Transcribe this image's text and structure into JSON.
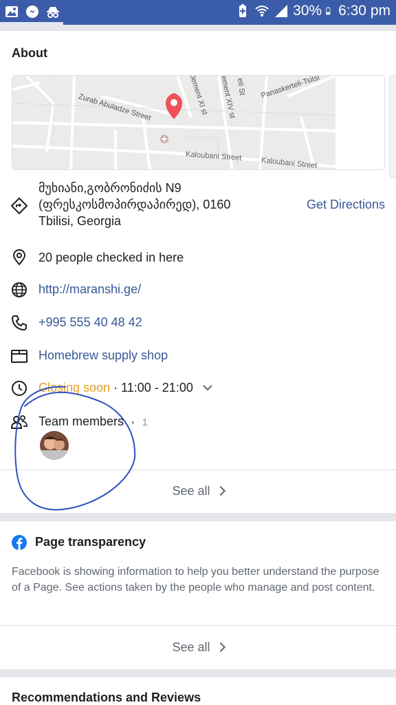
{
  "status_bar": {
    "battery": "30%",
    "time": "6:30 pm",
    "color": "#3b5ca8",
    "left_icons": [
      "gallery-icon",
      "messenger-icon",
      "incognito-icon"
    ],
    "right_icons": [
      "battery-saver-icon",
      "wifi-icon",
      "signal-icon",
      "battery-icon"
    ]
  },
  "about": {
    "title": "About",
    "map": {
      "streets": [
        "Zurab Abuladze Street",
        "Kaloubani Street",
        "Kaloubani Street",
        "ttlement XI st",
        "ement XIV st",
        "eti St",
        "Panaskerteli-Tsitsi"
      ],
      "pin_color": "#f0505a"
    },
    "address_line1": "მუხიანი,გობრონიძის N9",
    "address_line2": "(ფრესკოსმოპირდაპირედ), 0160",
    "address_line3": "Tbilisi, Georgia",
    "directions_label": "Get Directions",
    "checkins": "20 people checked in here",
    "website": "http://maranshi.ge/",
    "phone": "+995 555 40 48 42",
    "category": "Homebrew supply shop",
    "hours_status": "Closing soon",
    "hours_separator": "·",
    "hours": "11:00 - 21:00",
    "team_label": "Team members",
    "team_bullet": "•",
    "team_count": "1",
    "see_all": "See all"
  },
  "transparency": {
    "title": "Page transparency",
    "text": "Facebook is showing information to help you better understand the purpose of a Page. See actions taken by the people who manage and post content.",
    "see_all": "See all"
  },
  "recommendations": {
    "title": "Recommendations and Reviews"
  },
  "colors": {
    "link": "#385898",
    "orange": "#e9a023",
    "annotation": "#2c4fbf",
    "facebook_blue": "#1877f2"
  }
}
